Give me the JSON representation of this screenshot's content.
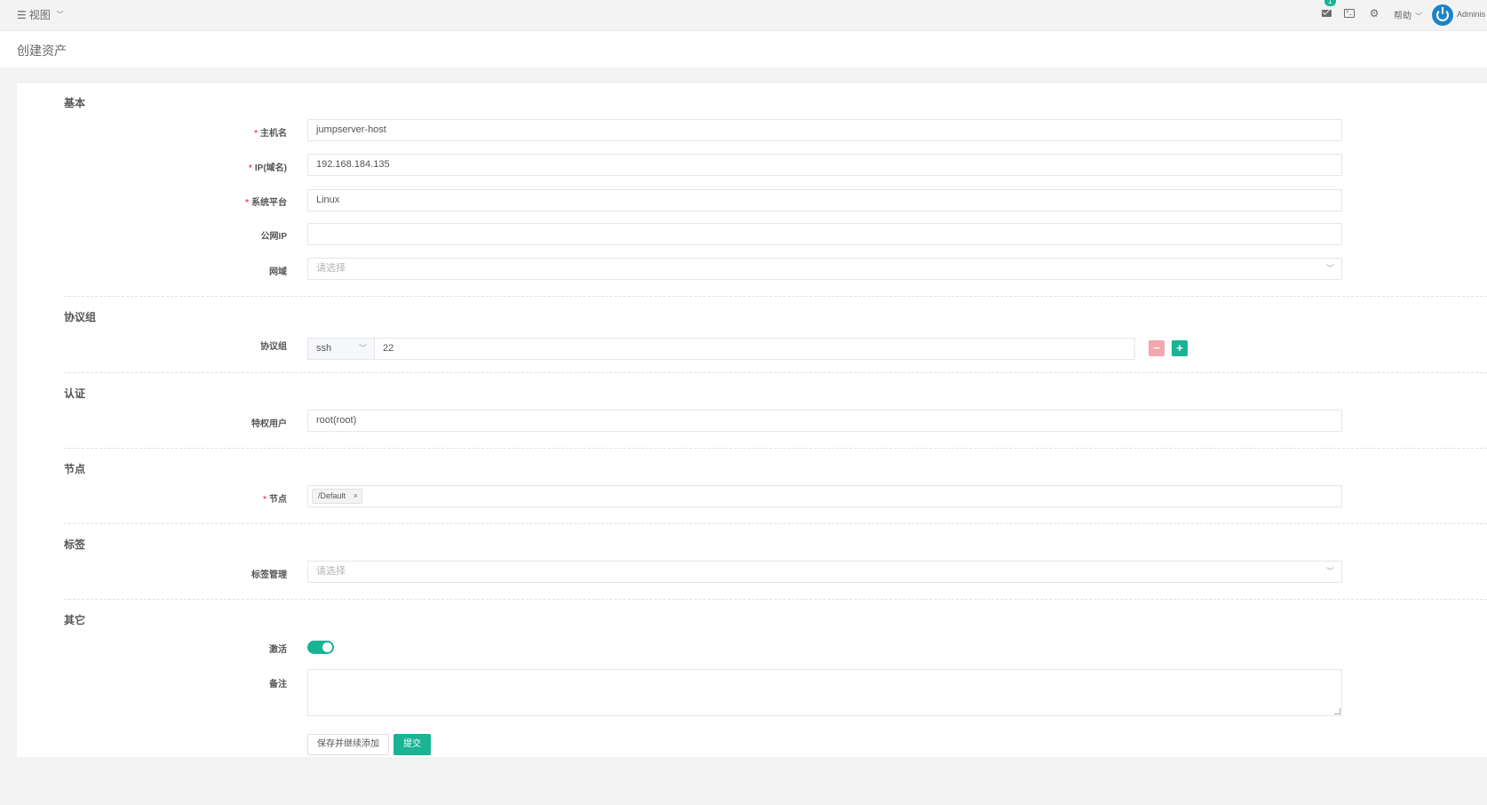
{
  "topbar": {
    "view_label": "视图",
    "notifications_count": "1",
    "help_label": "帮助",
    "username": "Adminis"
  },
  "page": {
    "title": "创建资产"
  },
  "sections": {
    "basic": "基本",
    "protocols": "协议组",
    "auth": "认证",
    "nodes": "节点",
    "labels": "标签",
    "other": "其它"
  },
  "fields": {
    "hostname": {
      "label": "主机名",
      "value": "jumpserver-host",
      "required": true
    },
    "ip": {
      "label": "IP(域名)",
      "value": "192.168.184.135",
      "required": true
    },
    "platform": {
      "label": "系统平台",
      "value": "Linux",
      "required": true
    },
    "public_ip": {
      "label": "公网IP",
      "value": ""
    },
    "domain": {
      "label": "网域",
      "placeholder": "请选择"
    },
    "protocols": {
      "label": "协议组",
      "protocol": "ssh",
      "port": "22"
    },
    "admin_user": {
      "label": "特权用户",
      "value": "root(root)"
    },
    "nodes": {
      "label": "节点",
      "tag": "/Default",
      "required": true
    },
    "labels": {
      "label": "标签管理",
      "placeholder": "请选择"
    },
    "active": {
      "label": "激活",
      "on": true
    },
    "comment": {
      "label": "备注",
      "value": ""
    }
  },
  "buttons": {
    "save_continue": "保存并继续添加",
    "submit": "提交"
  },
  "colors": {
    "primary": "#1ab394",
    "danger_light": "#f3a6ae",
    "required": "#ed5565",
    "avatar": "#1c84c6"
  }
}
